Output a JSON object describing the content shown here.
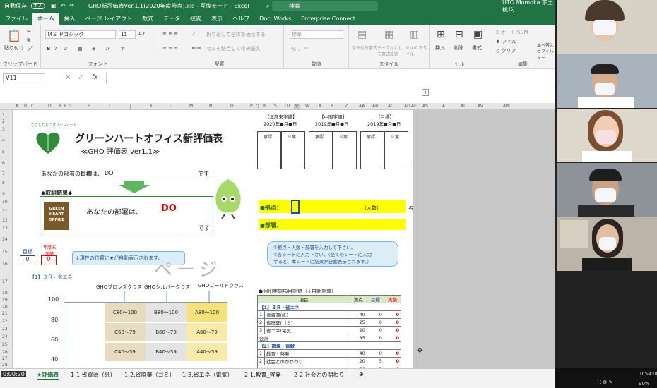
{
  "window": {
    "autosave": "自動保存",
    "toggle": "オフ",
    "title": "GHO新評価表Ver.1.1(2020年度時点).xls - 互換モード - Excel",
    "search": "検索",
    "user": "UTO Momoka 宇土 桃花"
  },
  "tabs": [
    "ファイル",
    "ホーム",
    "挿入",
    "ページ レイアウト",
    "数式",
    "データ",
    "校閲",
    "表示",
    "ヘルプ",
    "DocuWorks",
    "Enterprise Connect"
  ],
  "ribbon": {
    "paste": "貼り付け",
    "clipboard": "クリップボード",
    "font_name": "ＭＳ Ｐゴシック",
    "font_size": "11",
    "font": "フォント",
    "wrap": "折り返して全体を表示する",
    "merge": "セルを結合して中央揃え",
    "align": "配置",
    "numfmt": "標準",
    "number": "数値",
    "cond": "条件付き書式",
    "table": "テーブルとして書式設定",
    "cellstyle": "セルのスタイル",
    "style": "スタイル",
    "insert": "挿入",
    "delete": "削除",
    "format": "書式",
    "cell": "セル",
    "autosum": "オート SUM",
    "fill": "フィル",
    "clear": "クリア",
    "sortfilter": "並べ替えとフィルター",
    "edit": "編集"
  },
  "formula": {
    "namebox": "V11",
    "fx": "fx"
  },
  "columns": [
    "A",
    "B",
    "C",
    "D",
    "E",
    "F",
    "G",
    "H",
    "I",
    "J",
    "K",
    "L",
    "M",
    "N",
    "O",
    "P",
    "Q",
    "R",
    "S",
    "T",
    "U",
    "V",
    "W",
    "X",
    "Y",
    "Z",
    "AA",
    "AB",
    "AC",
    "AD",
    "AE",
    "AS",
    "AT",
    "AU",
    "AV",
    "AW"
  ],
  "rows": [
    "1",
    "2",
    "3",
    "4",
    "5",
    "6",
    "7",
    "8",
    "9",
    "10",
    "11",
    "12",
    "13",
    "14",
    "15",
    "16",
    "17",
    "18",
    "19",
    "20",
    "21",
    "22",
    "23",
    "24",
    "25",
    "26",
    "27",
    "28"
  ],
  "sheet": {
    "org_small": "むさしむらにグリーンハート",
    "title": "グリーンハートオフィス新評価表",
    "subtitle": "≪GHO 評価表 ver1.1≫",
    "goal_prefix": "あなたの部署の",
    "goal_bold": "目標",
    "goal_mid": "は、",
    "goal_value": "DO",
    "goal_suffix": "です",
    "result_header": "◆取組結果◆",
    "logo_lines": [
      "GREEN",
      "HEART",
      "OFFICE"
    ],
    "result_text": "あなたの部署は、",
    "result_value": "DO",
    "result_suffix": "です",
    "checks": [
      {
        "head": "【年度末実績】",
        "date": "2020年●月●日"
      },
      {
        "head": "【中間実績】",
        "date": "2019年●月●日"
      },
      {
        "head": "【目標】",
        "date": "2019年●月●日"
      }
    ],
    "sign_labels": [
      "承認",
      "立案"
    ],
    "base_label": "●拠点：",
    "people_label": "（人数）",
    "dept_label": "●部署：",
    "side_char": "名",
    "target_label": "目標",
    "actual_label": "年度末実績",
    "target_value": "0",
    "actual_value": "0",
    "note_left": "↓現在の位置に★が自動表示されます。",
    "note_right": [
      "①拠点・人数・部署を入力して下さい。",
      "②各シートに入力下さい。（全てのシートに入力",
      "すると、本シートに結果が自動表示されます。）"
    ],
    "watermark": "ページ",
    "section1": "【1】３Ｒ・省エネ",
    "grades": [
      "GHOブロンズクラス",
      "GHOシルバークラス",
      "GHOゴールドクラス"
    ],
    "yaxis": [
      "100",
      "80",
      "60",
      "40"
    ],
    "cells": [
      [
        "C80～100",
        "B80～100",
        "A80～100"
      ],
      [
        "C60～79",
        "B60～79",
        "A60～79"
      ],
      [
        "C40～59",
        "B40～59",
        "A40～59"
      ]
    ],
    "table_title": "●個別実施項目評価（↓自動計算）",
    "table_headers": [
      "項目",
      "満点",
      "目標",
      "実績"
    ],
    "table_rows": [
      [
        "【1】３Ｒ・省エネ",
        "",
        "",
        ""
      ],
      [
        "1",
        "省資源(紙)",
        "40",
        "0",
        "0"
      ],
      [
        "2",
        "省廃棄(ゴミ)",
        "25",
        "0",
        "0"
      ],
      [
        "3",
        "省エネ(電気)",
        "20",
        "0",
        "0"
      ],
      [
        "合計",
        "",
        "85",
        "0",
        "0"
      ],
      [
        "【2】環境・貢献",
        "",
        "",
        ""
      ],
      [
        "1",
        "教育・啓発",
        "40",
        "0",
        "0"
      ],
      [
        "2",
        "社会とのかかわり",
        "20",
        "5",
        "0"
      ],
      [
        "合計",
        "",
        "60",
        "5",
        "0"
      ]
    ]
  },
  "sheet_tabs": [
    "★評価表",
    "1-1.省資源（紙）",
    "1-2.省廃棄（ゴミ）",
    "1-3.省エネ（電気）",
    "2-1.教育_啓発",
    "2-2.社会との関わり"
  ],
  "video": {
    "elapsed": "0:00:20",
    "remaining": "0:54:08",
    "zoom": "90%"
  },
  "colors": {
    "excel_green": "#217346",
    "yellow": "#ffff00",
    "gho_green": "#2e8b3a",
    "red": "#e00000",
    "blue": "#1f4fa0"
  }
}
